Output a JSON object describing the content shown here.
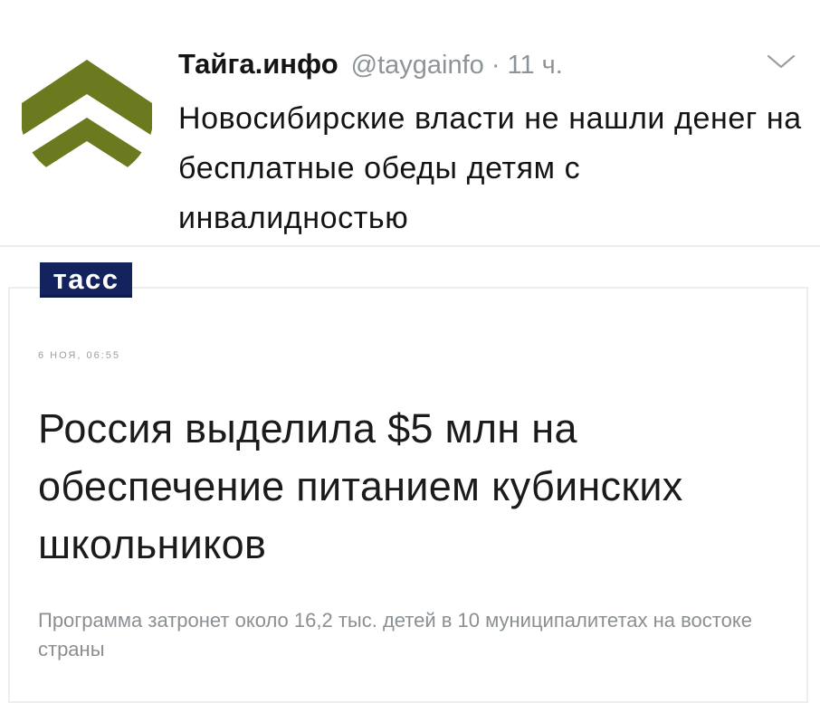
{
  "tweet": {
    "author_name": "Тайга.инфо",
    "handle": "@taygainfo",
    "separator": "·",
    "time": "11 ч.",
    "text": "Новосибирские власти не нашли денег на бесплатные обеды детям с инвалидностью",
    "avatar_icon": "chevron-up-logo-icon",
    "menu_icon": "chevron-down-icon",
    "colors": {
      "avatar_green": "#6b7a1e",
      "handle_gray": "#8d9499"
    }
  },
  "article": {
    "source_logo": "тасс",
    "date": "6 НОЯ, 06:55",
    "title": "Россия выделила $5 млн на обеспечение питанием кубинских школьников",
    "lead": "Программа затронет около 16,2 тыс. детей в 10 муниципалитетах на востоке страны",
    "colors": {
      "logo_bg": "#12235e"
    }
  }
}
